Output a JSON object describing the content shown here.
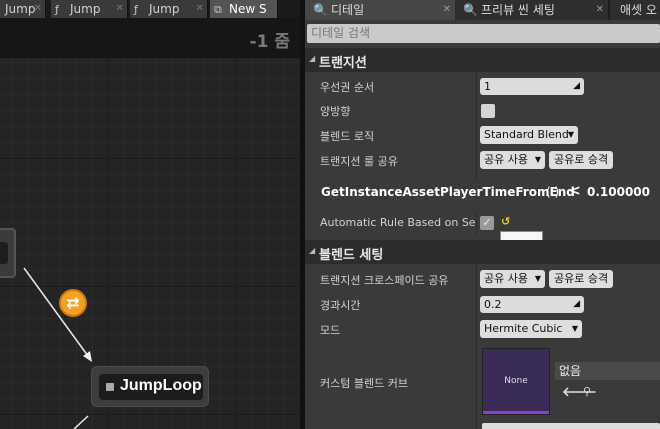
{
  "graph": {
    "tabs": [
      {
        "label": "Jump",
        "icon": "function-icon"
      },
      {
        "label": "Jump",
        "icon": "function-icon"
      },
      {
        "label": "Jump",
        "icon": "function-icon"
      },
      {
        "label": "New S",
        "icon": "state-machine-icon"
      }
    ],
    "zoom": "-1 줌",
    "node_label": "JumpLoop"
  },
  "details": {
    "tabs": [
      {
        "label": "디테일",
        "icon": "magnifier-icon"
      },
      {
        "label": "프리뷰 씬 세팅",
        "icon": "magnifier-icon"
      },
      {
        "label": "애셋 오",
        "icon": ""
      }
    ],
    "search_placeholder": "디테일 검색",
    "transition": {
      "header": "트랜지션",
      "priority_label": "우선권 순서",
      "priority_value": "1",
      "bidirectional_label": "양방향",
      "blend_logic_label": "블렌드 로직",
      "blend_logic_value": "Standard Blend",
      "rule_share_label": "트랜지션 룰 공유",
      "share_use": "공유 사용",
      "promote_share": "공유로 승격",
      "function_name": "GetInstanceAssetPlayerTimeFromEnd",
      "function_parens": "( )",
      "operator": "<",
      "threshold": "0.100000",
      "auto_rule_label": "Automatic Rule Based on Sequence Player in State",
      "auto_rule_value": "True"
    },
    "blend": {
      "header": "블렌드 세팅",
      "crossfade_label": "트랜지션 크로스페이드 공유",
      "share_use": "공유 사용",
      "promote_share": "공유로 승격",
      "duration_label": "경과시간",
      "duration_value": "0.2",
      "mode_label": "모드",
      "mode_value": "Hermite Cubic",
      "curve_label": "커스텀 블렌드 커브",
      "curve_thumb": "None",
      "curve_asset": "없음"
    }
  },
  "colors": {
    "accent_orange": "#f5a020",
    "curve_purple": "#8a3fd0",
    "reset_yellow": "#e5d020"
  }
}
